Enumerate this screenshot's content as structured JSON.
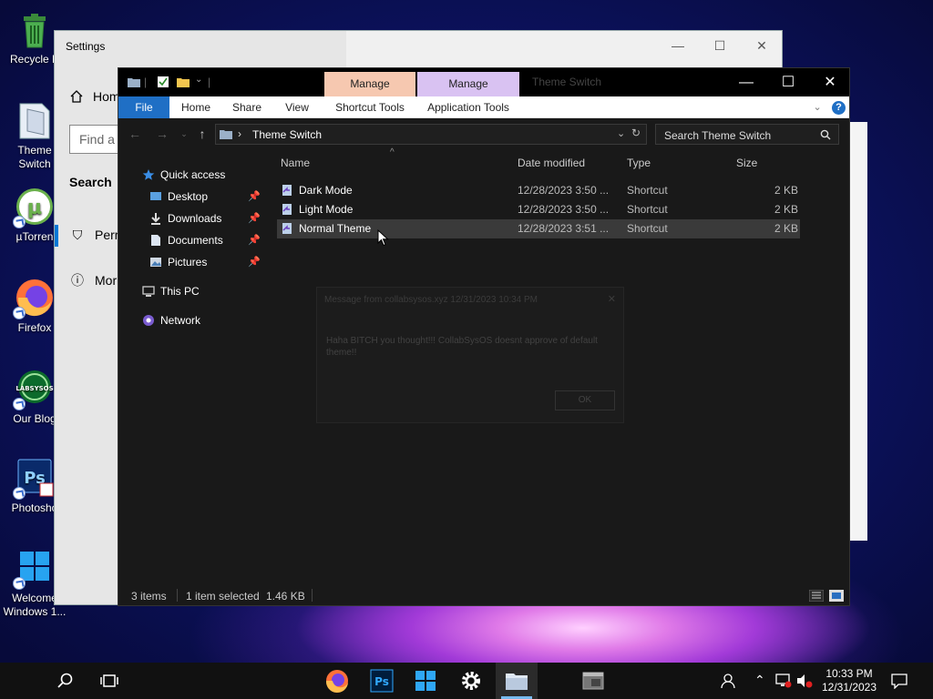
{
  "desktop": {
    "icons": [
      {
        "label": "Recycle B",
        "icon": "recycle-bin-icon"
      },
      {
        "label": "Theme",
        "label2": "Switch",
        "icon": "folder-icon"
      },
      {
        "label": "µTorren",
        "icon": "utorrent-icon"
      },
      {
        "label": "Firefox",
        "icon": "firefox-icon"
      },
      {
        "label": "Our Blog",
        "icon": "blog-icon"
      },
      {
        "label": "Photosho",
        "icon": "photoshop-icon"
      },
      {
        "label": "Welcome",
        "label2": "Windows 1...",
        "icon": "windows-icon"
      }
    ]
  },
  "settings": {
    "title": "Settings",
    "home": "Hom",
    "find_placeholder": "Find a",
    "search_heading": "Search",
    "items": [
      {
        "label": "Perm",
        "icon": "permissions-icon"
      },
      {
        "label": "Mor",
        "icon": "info-icon"
      }
    ],
    "caption": {
      "minimize": "—",
      "maximize": "☐",
      "close": "✕"
    }
  },
  "explorer": {
    "window_title": "Theme Switch",
    "manage_tabs": [
      {
        "label": "Manage",
        "color": "#f6c8b0"
      },
      {
        "label": "Manage",
        "color": "#d9c2f2"
      }
    ],
    "caption": {
      "minimize": "—",
      "maximize": "☐",
      "close": "✕"
    },
    "ribbon_tabs": [
      "File",
      "Home",
      "Share",
      "View",
      "Shortcut Tools",
      "Application Tools"
    ],
    "help": "?",
    "address": {
      "path": "Theme Switch",
      "separator": "›"
    },
    "search_placeholder": "Search Theme Switch",
    "nav": {
      "quick_access": "Quick access",
      "pinned": [
        {
          "label": "Desktop",
          "icon": "desktop-icon"
        },
        {
          "label": "Downloads",
          "icon": "downloads-icon"
        },
        {
          "label": "Documents",
          "icon": "documents-icon"
        },
        {
          "label": "Pictures",
          "icon": "pictures-icon"
        }
      ],
      "this_pc": "This PC",
      "network": "Network"
    },
    "columns": {
      "name": "Name",
      "date": "Date modified",
      "type": "Type",
      "size": "Size"
    },
    "files": [
      {
        "name": "Dark Mode",
        "date": "12/28/2023 3:50 ...",
        "type": "Shortcut",
        "size": "2 KB",
        "selected": false
      },
      {
        "name": "Light Mode",
        "date": "12/28/2023 3:50 ...",
        "type": "Shortcut",
        "size": "2 KB",
        "selected": false
      },
      {
        "name": "Normal Theme",
        "date": "12/28/2023 3:51 ...",
        "type": "Shortcut",
        "size": "2 KB",
        "selected": true
      }
    ],
    "dialog": {
      "title": "Message from collabsysos.xyz 12/31/2023 10:34 PM",
      "message": "Haha BITCH you thought!!! CollabSysOS doesnt approve of default theme!!",
      "ok": "OK"
    },
    "status": {
      "count": "3 items",
      "selected": "1 item selected",
      "size": "1.46 KB"
    }
  },
  "taskbar": {
    "apps": [
      "firefox",
      "photoshop",
      "file-explorer-tiles",
      "settings",
      "file-explorer",
      "app-window"
    ],
    "photoshop_label": "Ps",
    "clock": {
      "time": "10:33 PM",
      "date": "12/31/2023"
    }
  },
  "colors": {
    "ribbon_file": "#1f6fc5",
    "selection": "#3a3a3a",
    "accent": "#0078d7"
  }
}
